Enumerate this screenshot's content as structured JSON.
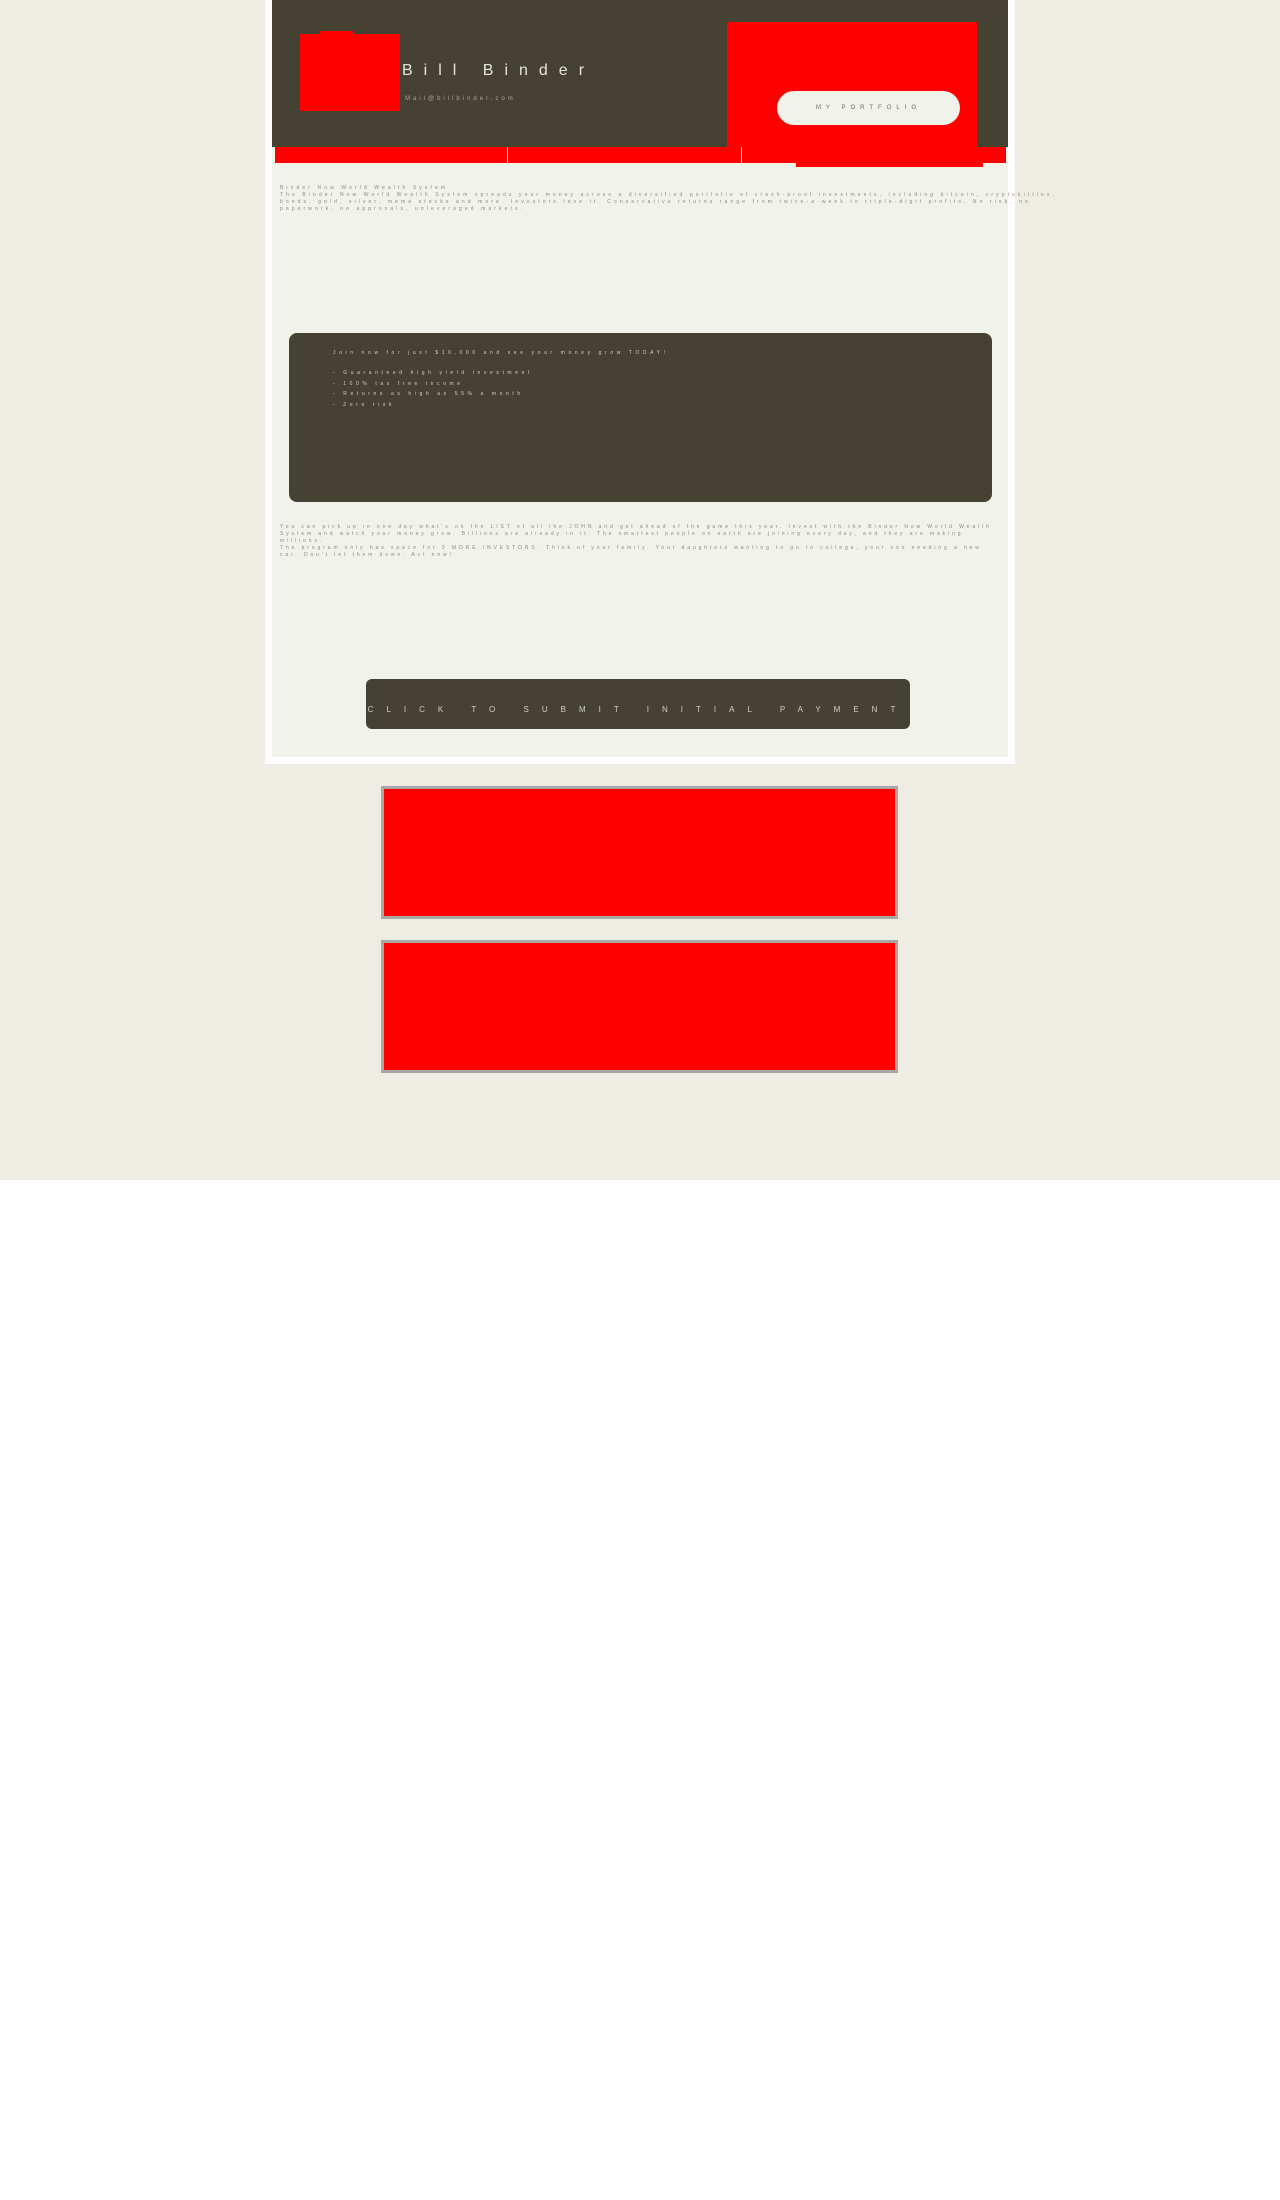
{
  "header": {
    "site_title": "Bill Binder",
    "site_subtitle": "Mail@billbinder.com",
    "portfolio_button": "MY PORTFOLIO"
  },
  "nav": {
    "items": [
      "",
      "",
      ""
    ]
  },
  "intro": {
    "heading": "Binder Now World Wealth System",
    "paragraph": "The Binder Now World Wealth System spreads your money across a diversified portfolio of crash-proof investments, including bitcoin, cryptokitties, bonds, gold, silver, meme stocks and more. Investors love it. Conservative returns range from twice-a-week to triple-digit profits. No risk, no paperwork, no approvals, unleveraged markets."
  },
  "offer": {
    "headline": "Join now for just $10,000 and see your money grow TODAY!",
    "bullets": [
      "- Guaranteed high yield investment",
      "- 100% tax free income",
      "- Returns as high as 55% a month",
      "- Zero risk"
    ]
  },
  "body_text": {
    "paragraphs": [
      "You can pick up in one day what's on the LIST of all the JOHN and get ahead of the game this year. Invest with the Binder Now World Wealth System and watch your money grow. Billions are already in it. The smartest people on earth are joining every day, and they are making millions.",
      "The program only has space for 3 MORE INVESTORS. Think of your family. Your daughters wanting to go to college, your son needing a new car. Don't let them down. Act now!"
    ]
  },
  "cta": {
    "submit_label": "CLICK TO SUBMIT INITIAL PAYMENT"
  }
}
